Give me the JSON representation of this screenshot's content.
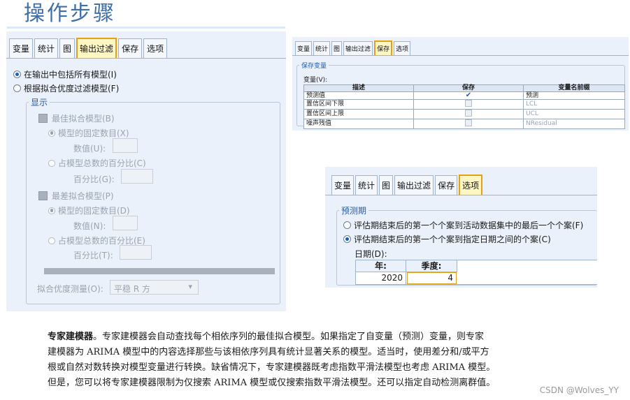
{
  "page_title": "操作步骤",
  "filter_dialog": {
    "tabs": [
      "变量",
      "统计",
      "图",
      "输出过滤",
      "保存",
      "选项"
    ],
    "active_tab": 3,
    "radio_include_all": "在输出中包括所有模型(I)",
    "radio_filter_fit": "根据拟合优度过滤模型(F)",
    "group_display": "显示",
    "best_fit_check": "最佳拟合模型(B)",
    "best_fixed_number": "模型的固定数目(X)",
    "best_number_label": "数值(U):",
    "best_percent_option": "占模型总数的百分比(C)",
    "best_percent_label": "百分比(G):",
    "worst_fit_check": "最差拟合模型(P)",
    "worst_fixed_number": "模型的固定数目(D)",
    "worst_number_label": "数值(N):",
    "worst_percent_option": "占模型总数的百分比(E)",
    "worst_percent_label": "百分比(T):",
    "fit_measure_label": "拟合优度测量(O):",
    "fit_measure_value": "平稳 R 方"
  },
  "save_dialog": {
    "tabs": [
      "变量",
      "统计",
      "图",
      "输出过滤",
      "保存",
      "选项"
    ],
    "active_tab": 4,
    "group_label": "保存变量",
    "variables_label": "变量(V):",
    "columns": [
      "描述",
      "保存",
      "变量名前缀"
    ],
    "rows": [
      {
        "description": "预测值",
        "save": true,
        "prefix": "预测"
      },
      {
        "description": "置信区间下限",
        "save": false,
        "prefix": "LCL"
      },
      {
        "description": "置信区间上限",
        "save": false,
        "prefix": "UCL"
      },
      {
        "description": "噪声残值",
        "save": false,
        "prefix": "NResidual"
      }
    ]
  },
  "options_dialog": {
    "tabs": [
      "变量",
      "统计",
      "图",
      "输出过滤",
      "保存",
      "选项"
    ],
    "active_tab": 5,
    "group_label": "预测期",
    "radio_first": "评估期结束后的第一个个案到活动数据集中的最后一个个案(F)",
    "radio_second": "评估期结束后的第一个个案到指定日期之间的个案(C)",
    "date_label": "日期(D):",
    "year_header": "年:",
    "quarter_header": "季度:",
    "year_value": "2020",
    "quarter_value": "4"
  },
  "paragraph": {
    "lead": "专家建模器",
    "line1": "。专家建模器会自动查找每个相依序列的最佳拟合模型。如果指定了自变量（预测）变量，则专家",
    "line2": "建模器为 ARIMA 模型中的内容选择那些与该相依序列具有统计显著关系的模型。适当时，使用差分和/或平方",
    "line3": "根或自然对数转换对模型变量进行转换。缺省情况下，专家建模器既考虑指数平滑法模型也考虑 ARIMA 模型。",
    "line4": "但是，您可以将专家建模器限制为仅搜索 ARIMA 模型或仅搜索指数平滑法模型。还可以指定自动检测离群值。"
  },
  "watermark": "CSDN @Wolves_YY",
  "colors": {
    "title": "#3f6fa6",
    "panel": "#eaf1fa",
    "active_tab": "#fff7c2",
    "active_tab_border": "#e1a21a",
    "radio_dot": "#1e5bbf"
  }
}
